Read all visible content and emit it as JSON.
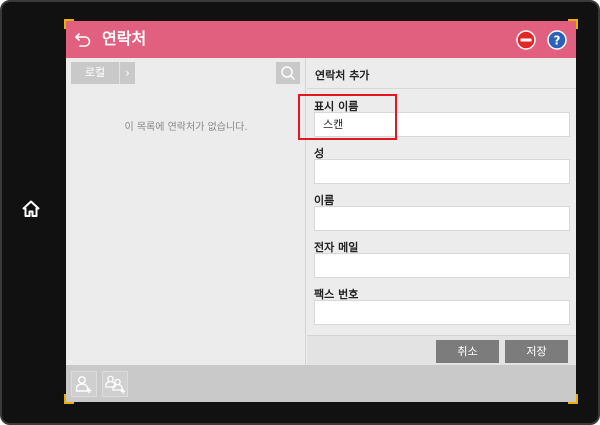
{
  "header": {
    "title": "연락처",
    "back_icon": "back-arrow-icon",
    "stop_icon": "stop-icon",
    "help_icon": "help-icon",
    "bar_color": "#e2607f"
  },
  "left_pane": {
    "location_label": "로컬",
    "empty_message": "이 목록에 연락처가 없습니다."
  },
  "form": {
    "title": "연락처 추가",
    "fields": [
      {
        "label": "표시 이름",
        "value": "스캔"
      },
      {
        "label": "성",
        "value": ""
      },
      {
        "label": "이름",
        "value": ""
      },
      {
        "label": "전자 메일",
        "value": ""
      },
      {
        "label": "팩스 번호",
        "value": ""
      }
    ],
    "cancel_label": "취소",
    "save_label": "저장"
  },
  "colors": {
    "accent": "#e2607f",
    "highlight": "#e4161f",
    "frame_corner": "#e8b000"
  }
}
